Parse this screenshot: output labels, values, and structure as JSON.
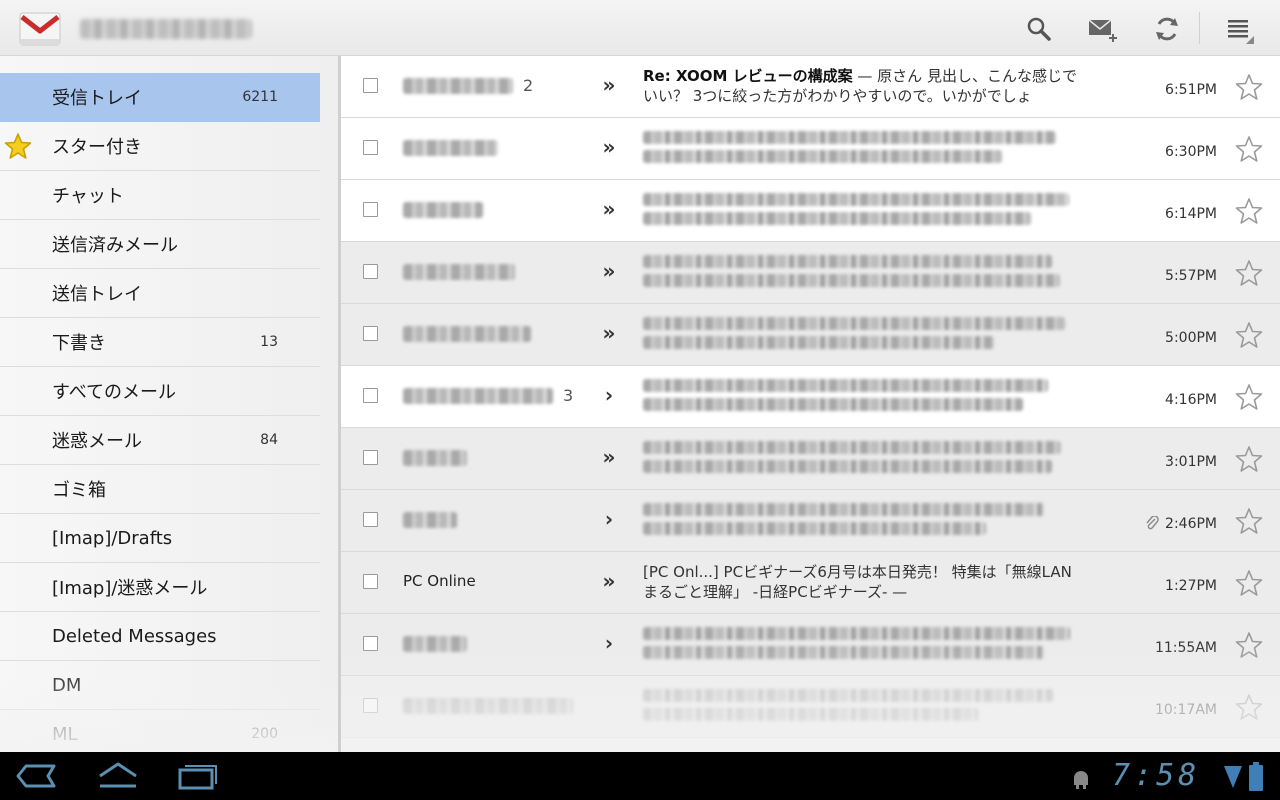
{
  "app": {
    "account": "",
    "colors": {
      "selected_nav": "#a8c5ee",
      "star_active": "#f4cc22",
      "clock": "#5c8fb0"
    }
  },
  "toolbar": {
    "icons": [
      "search-icon",
      "compose-icon",
      "refresh-icon",
      "menu-icon"
    ]
  },
  "nav": {
    "items": [
      {
        "label": "受信トレイ",
        "count": "6211",
        "selected": true
      },
      {
        "label": "スター付き",
        "count": "",
        "starred_icon": true
      },
      {
        "label": "チャット",
        "count": ""
      },
      {
        "label": "送信済みメール",
        "count": ""
      },
      {
        "label": "送信トレイ",
        "count": ""
      },
      {
        "label": "下書き",
        "count": "13"
      },
      {
        "label": "すべてのメール",
        "count": ""
      },
      {
        "label": "迷惑メール",
        "count": "84"
      },
      {
        "label": "ゴミ箱",
        "count": ""
      },
      {
        "label": "[Imap]/Drafts",
        "count": ""
      },
      {
        "label": "[Imap]/迷惑メール",
        "count": ""
      },
      {
        "label": "Deleted Messages",
        "count": ""
      },
      {
        "label": "DM",
        "count": ""
      },
      {
        "label": "ML",
        "count": "200"
      }
    ]
  },
  "messages": [
    {
      "sender": "",
      "count": "2",
      "chevron": "»",
      "subject_bold": "Re: XOOM レビューの構成案",
      "snippet": " — 原さん 見出し、こんな感じでいい？ 3つに絞った方がわかりやすいので。いかがでしょ",
      "time": "6:51PM",
      "read": false,
      "attachment": false
    },
    {
      "sender": "",
      "count": "",
      "chevron": "»",
      "subject_bold": "",
      "snippet": "",
      "time": "6:30PM",
      "read": false,
      "attachment": false
    },
    {
      "sender": "",
      "count": "",
      "chevron": "»",
      "subject_bold": "",
      "snippet": "",
      "time": "6:14PM",
      "read": false,
      "attachment": false
    },
    {
      "sender": "",
      "count": "",
      "chevron": "»",
      "subject_bold": "",
      "snippet": "",
      "time": "5:57PM",
      "read": true,
      "attachment": false
    },
    {
      "sender": "",
      "count": "",
      "chevron": "»",
      "subject_bold": "",
      "snippet": "",
      "time": "5:00PM",
      "read": true,
      "attachment": false
    },
    {
      "sender": "",
      "count": "3",
      "chevron": "›",
      "subject_bold": "",
      "snippet": "",
      "time": "4:16PM",
      "read": false,
      "attachment": false
    },
    {
      "sender": "",
      "count": "",
      "chevron": "»",
      "subject_bold": "",
      "snippet": "",
      "time": "3:01PM",
      "read": true,
      "attachment": false
    },
    {
      "sender": "",
      "count": "",
      "chevron": "›",
      "subject_bold": "",
      "snippet": "",
      "time": "2:46PM",
      "read": true,
      "attachment": true
    },
    {
      "sender": "PC Online",
      "count": "",
      "chevron": "»",
      "subject_bold": "",
      "snippet": "[PC Onl...] PCビギナーズ6月号は本日発売！ 特集は「無線LAN　まるごと理解」 -日経PCビギナーズ- —",
      "time": "1:27PM",
      "read": true,
      "attachment": false
    },
    {
      "sender": "",
      "count": "",
      "chevron": "›",
      "subject_bold": "",
      "snippet": "",
      "time": "11:55AM",
      "read": true,
      "attachment": false
    },
    {
      "sender": "",
      "count": "",
      "chevron": "",
      "subject_bold": "",
      "snippet": "",
      "time": "10:17AM",
      "read": true,
      "attachment": false
    }
  ],
  "system": {
    "clock": "7:58",
    "icons": [
      "back-icon",
      "home-icon",
      "recent-apps-icon",
      "android-debug-icon",
      "signal-icon",
      "battery-icon"
    ]
  }
}
